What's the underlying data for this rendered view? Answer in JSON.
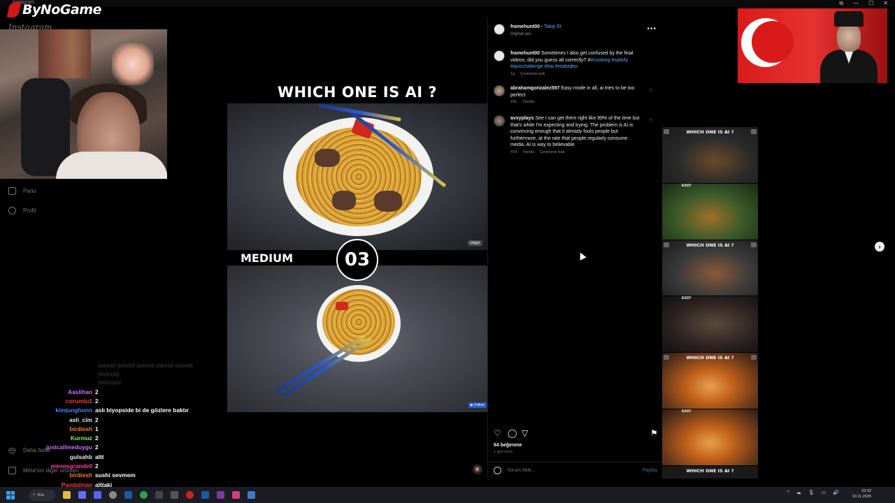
{
  "window": {
    "tab_title": "Instagram",
    "controls": [
      "⧉",
      "—",
      "☐",
      "✕"
    ]
  },
  "overlay": {
    "logo_text": "ByNoGame",
    "ig_wordmark": "Instagram"
  },
  "sidebar": {
    "items": [
      {
        "label": "Pano",
        "icon": "dashboard-icon"
      },
      {
        "label": "Profil",
        "icon": "profile-icon"
      }
    ],
    "more_label": "Daha fazla",
    "meta_label": "Meta'nın diğer ürünleri"
  },
  "chat": {
    "faded": [
      "dakeldi dakeldi dakeldi dakeldi dakeldi",
      "jdejksjdjj",
      "jdejksjdjd"
    ],
    "messages": [
      {
        "user": "Aaslihan",
        "msg": "2",
        "color": "#c870ff"
      },
      {
        "user": "corumlu1",
        "msg": "2",
        "color": "#ff3a3a"
      },
      {
        "user": "kimjunghunn",
        "msg": "aslı biyopside bi de gözlere baktır",
        "color": "#3a8aff"
      },
      {
        "user": "asli_cim",
        "msg": "2",
        "color": "#e8e8e8"
      },
      {
        "user": "birdiesh",
        "msg": "1",
        "color": "#ff7a1a"
      },
      {
        "user": "Kurmuz",
        "msg": "2",
        "color": "#7aff3a"
      },
      {
        "user": "justcallmeduygu",
        "msg": "2",
        "color": "#c870ff"
      },
      {
        "user": "gulsahb",
        "msg": "altt",
        "color": "#e8e8e8"
      },
      {
        "user": "menosgrande0",
        "msg": "2",
        "color": "#ff3aa0"
      },
      {
        "user": "birdiesh",
        "msg": "sushi sevmem",
        "color": "#ff7a1a"
      },
      {
        "user": "Pandalinay",
        "msg": "alttaki",
        "color": "#ff3a3a"
      }
    ]
  },
  "video": {
    "title": "WHICH ONE IS AI ?",
    "difficulty": "MEDIUM",
    "number": "03",
    "watermark_top": "⟨dogs⟩",
    "watermark_bottom": "▶ Follow"
  },
  "post": {
    "author": "framehunt00",
    "separator": "•",
    "follow_label": "Takip Et",
    "audio": "Orijinal ses",
    "more": "•••",
    "caption": {
      "text": "Sometimes I also get confused by the final videos, did you guess all correctly? #",
      "tags": "#cooking #satisfy #quizchallenge #",
      "tags2": "#ai #realvideo",
      "time": "1g",
      "translate": "Çevirisine bak"
    },
    "comments": [
      {
        "user": "abrahamgonzalez597",
        "text": "Easy mode in all, ai tries to be too perfect",
        "time": "23s",
        "reply": "Yanıtla"
      },
      {
        "user": "avxyplays",
        "text": "See I can get them right like 99% of the time but that's while I'm expecting and trying. The problem is AI is convincing enough that it already fools people but furthermore, at the rate that people regularly consume media, AI is way to believable",
        "time": "47d",
        "reply": "Yanıtla",
        "translate": "Çevirisine bak"
      }
    ],
    "likes": "64 beğenme",
    "ago": "1 gün önce",
    "comment_placeholder": "Yorum ekle...",
    "share_label": "Paylaş"
  },
  "thumbnails": [
    {
      "title": "WHICH ONE IS AI ?",
      "tag": "",
      "style": "t-grill"
    },
    {
      "title": "",
      "tag": "EASY",
      "style": "t-veg"
    },
    {
      "title": "WHICH ONE IS AI ?",
      "tag": "",
      "style": "t-burger"
    },
    {
      "title": "",
      "tag": "EASY",
      "style": "t-dark"
    },
    {
      "title": "WHICH ONE IS AI ?",
      "tag": "",
      "style": "t-hotdog"
    },
    {
      "title": "",
      "tag": "EASY",
      "style": "t-hotdog"
    }
  ],
  "last_thumb_title": "WHICH ONE IS AI ?",
  "taskbar": {
    "search_label": "Ara",
    "time": "23:02",
    "date": "10.11.2025",
    "tray": [
      "^",
      "☁",
      "🎙",
      "▭",
      "🔊"
    ]
  },
  "colors": {
    "accent_link": "#5aa8ff",
    "flag_red": "#d91a1a"
  }
}
